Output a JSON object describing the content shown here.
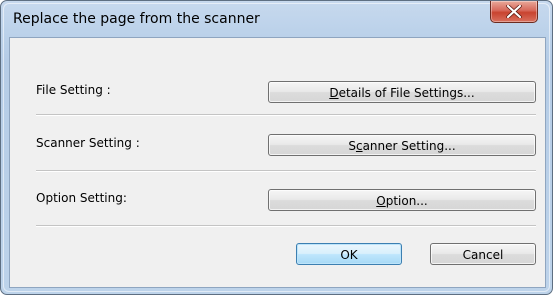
{
  "window": {
    "title": "Replace the page from the scanner"
  },
  "rows": [
    {
      "label": "File Setting :",
      "button_pre": "",
      "button_acc": "D",
      "button_post": "etails of File Settings..."
    },
    {
      "label": "Scanner Setting :",
      "button_pre": "S",
      "button_acc": "c",
      "button_post": "anner Setting..."
    },
    {
      "label": "Option Setting:",
      "button_pre": "",
      "button_acc": "O",
      "button_post": "ption..."
    }
  ],
  "footer": {
    "ok_label": "OK",
    "cancel_label": "Cancel"
  },
  "colors": {
    "frame": "#b9cfe8",
    "client": "#f0f0f0",
    "close": "#c8432f",
    "default_button_border": "#3c7fb1"
  },
  "icons": {
    "close": "close-x-icon"
  }
}
